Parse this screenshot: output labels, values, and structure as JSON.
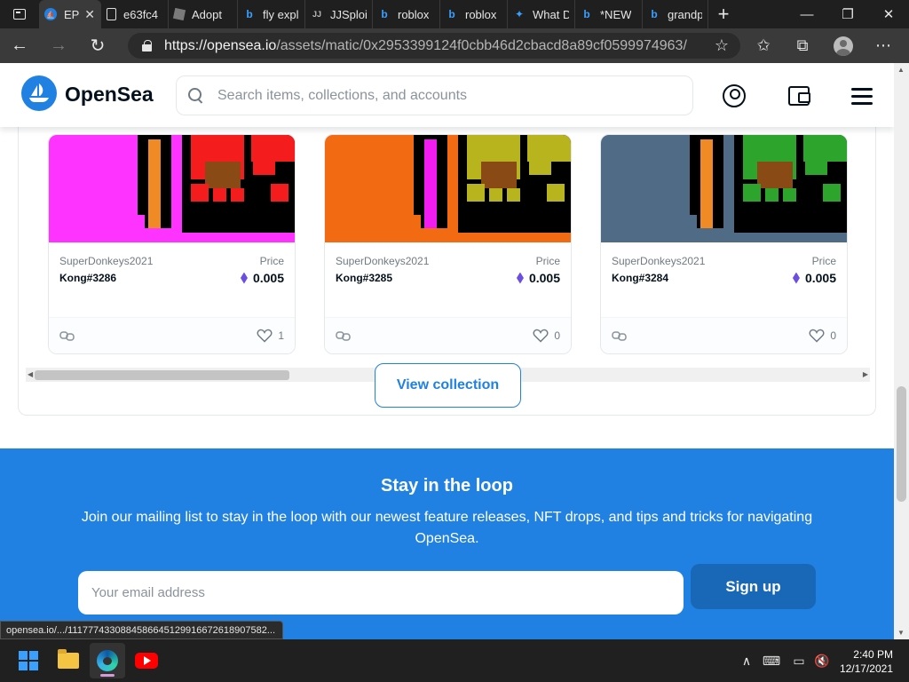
{
  "browser": {
    "tabs": [
      {
        "label": "EPI",
        "icon": "opensea",
        "active": true
      },
      {
        "label": "e63fc4",
        "icon": "document"
      },
      {
        "label": "Adopt",
        "icon": "roblox"
      },
      {
        "label": "fly expl",
        "icon": "bing"
      },
      {
        "label": "JJSploit",
        "icon": "jj"
      },
      {
        "label": "roblox",
        "icon": "bing"
      },
      {
        "label": "roblox",
        "icon": "bing"
      },
      {
        "label": "What D",
        "icon": "microsoft"
      },
      {
        "label": "*NEW",
        "icon": "bing"
      },
      {
        "label": "grandp",
        "icon": "bing"
      }
    ],
    "new_tab_label": "+",
    "url_host": "https://opensea.io",
    "url_path": "/assets/matic/0x2953399124f0cbb46d2cbacd8a89cf0599974963/...",
    "status_link": "opensea.io/.../1117774330884586645129916672618907582..."
  },
  "header": {
    "brand": "OpenSea",
    "search_placeholder": "Search items, collections, and accounts"
  },
  "items": [
    {
      "collection": "SuperDonkeys2021",
      "name": "Kong#3286",
      "price_label": "Price",
      "price": "0.005",
      "favorites": "1",
      "bg": "#ff33ff",
      "dark": "#f41c1c",
      "accent": "#f08a24"
    },
    {
      "collection": "SuperDonkeys2021",
      "name": "Kong#3285",
      "price_label": "Price",
      "price": "0.005",
      "favorites": "0",
      "bg": "#f26a12",
      "dark": "#b7b41d",
      "accent": "#f01cf0"
    },
    {
      "collection": "SuperDonkeys2021",
      "name": "Kong#3284",
      "price_label": "Price",
      "price": "0.005",
      "favorites": "0",
      "bg": "#4f6b85",
      "dark": "#2da52d",
      "accent": "#f08a24"
    }
  ],
  "view_collection_label": "View collection",
  "newsletter": {
    "title": "Stay in the loop",
    "description": "Join our mailing list to stay in the loop with our newest feature releases, NFT drops, and tips and tricks for navigating OpenSea.",
    "email_placeholder": "Your email address",
    "signup_label": "Sign up"
  },
  "taskbar": {
    "time": "2:40 PM",
    "date": "12/17/2021"
  },
  "colors": {
    "brand_blue": "#2081e2",
    "signup_blue": "#1868b7"
  }
}
